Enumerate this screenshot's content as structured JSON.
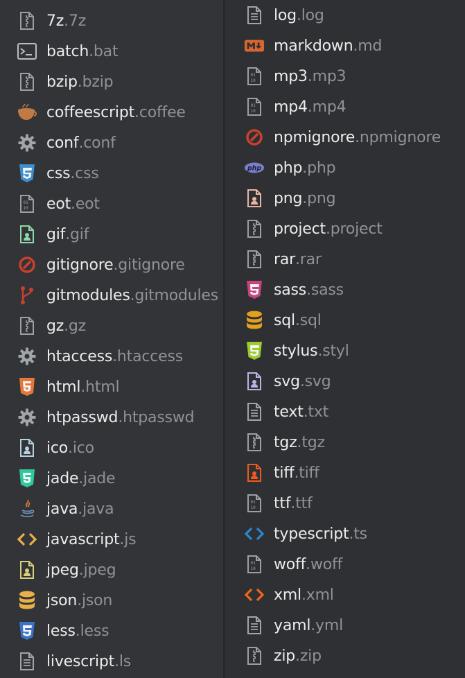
{
  "left_column": [
    {
      "name": "7z",
      "ext": ".7z",
      "icon": "zip-icon"
    },
    {
      "name": "batch",
      "ext": ".bat",
      "icon": "terminal-icon"
    },
    {
      "name": "bzip",
      "ext": ".bzip",
      "icon": "zip-icon"
    },
    {
      "name": "coffeescript",
      "ext": ".coffee",
      "icon": "coffee-icon"
    },
    {
      "name": "conf",
      "ext": ".conf",
      "icon": "gear-icon"
    },
    {
      "name": "css",
      "ext": ".css",
      "icon": "css3-icon"
    },
    {
      "name": "eot",
      "ext": ".eot",
      "icon": "binary-icon"
    },
    {
      "name": "gif",
      "ext": ".gif",
      "icon": "image-icon"
    },
    {
      "name": "gitignore",
      "ext": ".gitignore",
      "icon": "no-entry-icon"
    },
    {
      "name": "gitmodules",
      "ext": ".gitmodules",
      "icon": "git-branch-icon"
    },
    {
      "name": "gz",
      "ext": ".gz",
      "icon": "zip-icon"
    },
    {
      "name": "htaccess",
      "ext": ".htaccess",
      "icon": "gear-icon"
    },
    {
      "name": "html",
      "ext": ".html",
      "icon": "html5-icon"
    },
    {
      "name": "htpasswd",
      "ext": ".htpasswd",
      "icon": "gear-icon"
    },
    {
      "name": "ico",
      "ext": ".ico",
      "icon": "image-icon"
    },
    {
      "name": "jade",
      "ext": ".jade",
      "icon": "html5-icon"
    },
    {
      "name": "java",
      "ext": ".java",
      "icon": "java-icon"
    },
    {
      "name": "javascript",
      "ext": ".js",
      "icon": "code-icon"
    },
    {
      "name": "jpeg",
      "ext": ".jpeg",
      "icon": "image-icon"
    },
    {
      "name": "json",
      "ext": ".json",
      "icon": "database-icon"
    },
    {
      "name": "less",
      "ext": ".less",
      "icon": "css3-icon"
    },
    {
      "name": "livescript",
      "ext": ".ls",
      "icon": "text-file-icon"
    }
  ],
  "right_column": [
    {
      "name": "log",
      "ext": ".log",
      "icon": "text-file-icon"
    },
    {
      "name": "markdown",
      "ext": ".md",
      "icon": "markdown-icon"
    },
    {
      "name": "mp3",
      "ext": ".mp3",
      "icon": "binary-icon"
    },
    {
      "name": "mp4",
      "ext": ".mp4",
      "icon": "binary-icon"
    },
    {
      "name": "npmignore",
      "ext": ".npmignore",
      "icon": "no-entry-icon"
    },
    {
      "name": "php",
      "ext": ".php",
      "icon": "php-icon"
    },
    {
      "name": "png",
      "ext": ".png",
      "icon": "image-icon"
    },
    {
      "name": "project",
      "ext": ".project",
      "icon": "zip-icon"
    },
    {
      "name": "rar",
      "ext": ".rar",
      "icon": "zip-icon"
    },
    {
      "name": "sass",
      "ext": ".sass",
      "icon": "css3-icon"
    },
    {
      "name": "sql",
      "ext": ".sql",
      "icon": "database-icon"
    },
    {
      "name": "stylus",
      "ext": ".styl",
      "icon": "css3-icon"
    },
    {
      "name": "svg",
      "ext": ".svg",
      "icon": "image-icon"
    },
    {
      "name": "text",
      "ext": ".txt",
      "icon": "text-file-icon"
    },
    {
      "name": "tgz",
      "ext": ".tgz",
      "icon": "zip-icon"
    },
    {
      "name": "tiff",
      "ext": ".tiff",
      "icon": "image-icon"
    },
    {
      "name": "ttf",
      "ext": ".ttf",
      "icon": "binary-icon"
    },
    {
      "name": "typescript",
      "ext": ".ts",
      "icon": "code-icon"
    },
    {
      "name": "woff",
      "ext": ".woff",
      "icon": "binary-icon"
    },
    {
      "name": "xml",
      "ext": ".xml",
      "icon": "code-icon"
    },
    {
      "name": "yaml",
      "ext": ".yml",
      "icon": "text-file-icon"
    },
    {
      "name": "zip",
      "ext": ".zip",
      "icon": "zip-icon"
    }
  ],
  "icon_colors": {
    "7z": "#9aa0a6",
    "batch": "#b9bec4",
    "bzip": "#9aa0a6",
    "coffeescript": "#c07a45",
    "conf": "#a0a5ab",
    "css": "#3d8fd1",
    "eot": "#9aa0a6",
    "gif": "#8fd8a8",
    "gitignore": "#c8412f",
    "gitmodules": "#c8412f",
    "gz": "#9aa0a6",
    "htaccess": "#a0a5ab",
    "html": "#e5773a",
    "htpasswd": "#a0a5ab",
    "ico": "#b7d0e0",
    "jade": "#2fc9a0",
    "java": "#6a8fb8",
    "javascript": "#e8b04a",
    "jpeg": "#d8d07a",
    "json": "#e8b04a",
    "less": "#3a73c8",
    "livescript": "#a0a5ab",
    "log": "#a0a5ab",
    "markdown": "#d9662e",
    "mp3": "#9aa0a6",
    "mp4": "#9aa0a6",
    "npmignore": "#c8412f",
    "php": "#7b7fc8",
    "png": "#e9b6a6",
    "project": "#9aa0a6",
    "rar": "#9aa0a6",
    "sass": "#c7447f",
    "sql": "#e0a020",
    "stylus": "#9ccc2c",
    "svg": "#b6b6e6",
    "text": "#a0a5ab",
    "tgz": "#9aa0a6",
    "tiff": "#f05a1c",
    "ttf": "#9aa0a6",
    "typescript": "#2f86cf",
    "woff": "#9aa0a6",
    "xml": "#f0681c",
    "yaml": "#a0a5ab",
    "zip": "#9aa0a6"
  }
}
